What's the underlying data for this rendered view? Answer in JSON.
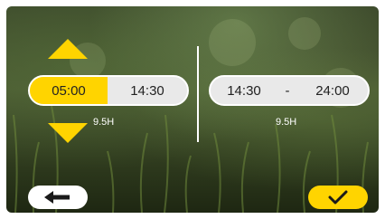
{
  "colors": {
    "accent": "#ffd400",
    "pill_background": "#e9e9e9",
    "text": "#222222",
    "overlay_text": "#ffffff"
  },
  "left_range": {
    "start": "05:00",
    "separator": "-",
    "end": "14:30",
    "duration": "9.5H",
    "active_segment": "start"
  },
  "right_range": {
    "start": "14:30",
    "separator": "-",
    "end": "24:00",
    "duration": "9.5H"
  },
  "controls": {
    "increment_icon": "triangle-up-icon",
    "decrement_icon": "triangle-down-icon",
    "back_icon": "arrow-left-icon",
    "confirm_icon": "checkmark-icon"
  }
}
